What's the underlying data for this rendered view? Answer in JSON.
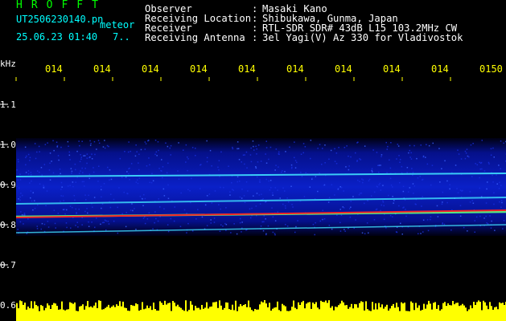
{
  "header": {
    "logo": "HROFFT",
    "filename": "UT2506230140.pn",
    "meteor_label": "meteor",
    "datetime": "25.06.23 01:40",
    "count": "7..",
    "fields": [
      {
        "key": "Observer",
        "value": "Masaki Kano"
      },
      {
        "key": "Receiving Location",
        "value": "Shibukawa, Gunma, Japan"
      },
      {
        "key": "Receiver",
        "value": "RTL-SDR SDR# 43dB L15 103.2MHz CW"
      },
      {
        "key": "Receiving Antenna",
        "value": "3el Yagi(V) Az 330 for Vladivostok"
      }
    ],
    "colon": ":"
  },
  "axis": {
    "y_unit": "kHz",
    "y_ticks": [
      "1.1",
      "1.0",
      "0.9",
      "0.8",
      "0.7",
      "0.6"
    ],
    "x_ticks": [
      "014",
      "014",
      "014",
      "014",
      "014",
      "014",
      "014",
      "014",
      "014",
      "0150"
    ]
  },
  "colors": {
    "header_green": "#00ff00",
    "header_cyan": "#00ffff",
    "time_yellow": "#ffff00",
    "noise_blue": "#1020c0",
    "line_cyan": "#40e0ff",
    "line_red": "#ff2020",
    "power_yellow": "#ffff00"
  }
}
